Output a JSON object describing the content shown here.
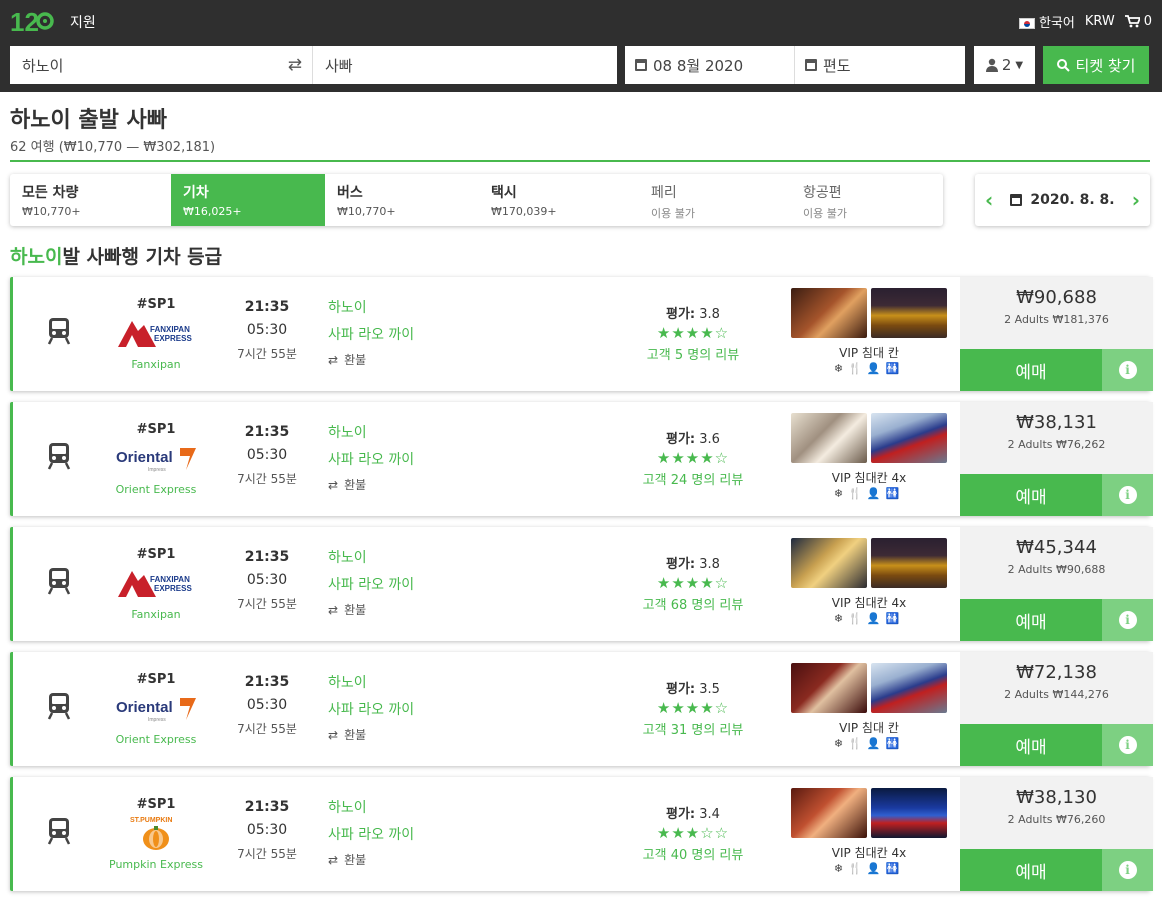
{
  "header": {
    "logo_text": "12Go",
    "support_label": "지원",
    "language_label": "한국어",
    "currency_label": "KRW",
    "cart_count": "0"
  },
  "search": {
    "from_value": "하노이",
    "to_value": "사빠",
    "date_value": "08 8월 2020",
    "return_value": "편도",
    "passengers": "2",
    "button_label": "티켓 찾기"
  },
  "page": {
    "title": "하노이 출발 사빠",
    "subtitle": "62 여행 (₩10,770 — ₩302,181)"
  },
  "tabs": [
    {
      "label": "모든 차량",
      "price": "₩10,770+"
    },
    {
      "label": "기차",
      "price": "₩16,025+"
    },
    {
      "label": "버스",
      "price": "₩10,770+"
    },
    {
      "label": "택시",
      "price": "₩170,039+"
    },
    {
      "label": "페리",
      "price": "이용 불가"
    },
    {
      "label": "항공편",
      "price": "이용 불가"
    }
  ],
  "date_nav": {
    "date": "2020. 8. 8."
  },
  "section": {
    "title_highlight": "하노이",
    "title_rest": "발 사빠행 기차 등급"
  },
  "trips": [
    {
      "code": "#SP1",
      "operator": "Fanxipan",
      "logo_type": "fanxipan",
      "depart": "21:35",
      "arrive": "05:30",
      "duration": "7시간 55분",
      "from": "하노이",
      "to": "사파 라오 까이",
      "refund": "환불",
      "rating_label": "평가:",
      "rating": "3.8",
      "stars": 4,
      "reviews": "고객 5 명의 리뷰",
      "seat_class": "VIP 침대 칸",
      "price": "₩90,688",
      "price_total": "2 Adults ₩181,376",
      "book": "예매"
    },
    {
      "code": "#SP1",
      "operator": "Orient Express",
      "logo_type": "oriental",
      "depart": "21:35",
      "arrive": "05:30",
      "duration": "7시간 55분",
      "from": "하노이",
      "to": "사파 라오 까이",
      "refund": "환불",
      "rating_label": "평가:",
      "rating": "3.6",
      "stars": 4,
      "reviews": "고객 24 명의 리뷰",
      "seat_class": "VIP 침대칸 4x",
      "price": "₩38,131",
      "price_total": "2 Adults ₩76,262",
      "book": "예매"
    },
    {
      "code": "#SP1",
      "operator": "Fanxipan",
      "logo_type": "fanxipan",
      "depart": "21:35",
      "arrive": "05:30",
      "duration": "7시간 55분",
      "from": "하노이",
      "to": "사파 라오 까이",
      "refund": "환불",
      "rating_label": "평가:",
      "rating": "3.8",
      "stars": 4,
      "reviews": "고객 68 명의 리뷰",
      "seat_class": "VIP 침대칸 4x",
      "price": "₩45,344",
      "price_total": "2 Adults ₩90,688",
      "book": "예매"
    },
    {
      "code": "#SP1",
      "operator": "Orient Express",
      "logo_type": "oriental",
      "depart": "21:35",
      "arrive": "05:30",
      "duration": "7시간 55분",
      "from": "하노이",
      "to": "사파 라오 까이",
      "refund": "환불",
      "rating_label": "평가:",
      "rating": "3.5",
      "stars": 4,
      "reviews": "고객 31 명의 리뷰",
      "seat_class": "VIP 침대 칸",
      "price": "₩72,138",
      "price_total": "2 Adults ₩144,276",
      "book": "예매"
    },
    {
      "code": "#SP1",
      "operator": "Pumpkin Express",
      "logo_type": "pumpkin",
      "depart": "21:35",
      "arrive": "05:30",
      "duration": "7시간 55분",
      "from": "하노이",
      "to": "사파 라오 까이",
      "refund": "환불",
      "rating_label": "평가:",
      "rating": "3.4",
      "stars": 3,
      "reviews": "고객 40 명의 리뷰",
      "seat_class": "VIP 침대칸 4x",
      "price": "₩38,130",
      "price_total": "2 Adults ₩76,260",
      "book": "예매"
    }
  ],
  "logos": {
    "fanxipan_text_1": "FANXIPAN",
    "fanxipan_text_2": "EXPRESS",
    "oriental_text": "Oriental",
    "oriental_sub": "Impress",
    "pumpkin_text": "ST.PUMPKIN"
  },
  "colors": {
    "accent": "#48b94e",
    "topbar": "#2f2f2f",
    "info": "#7dd082"
  }
}
